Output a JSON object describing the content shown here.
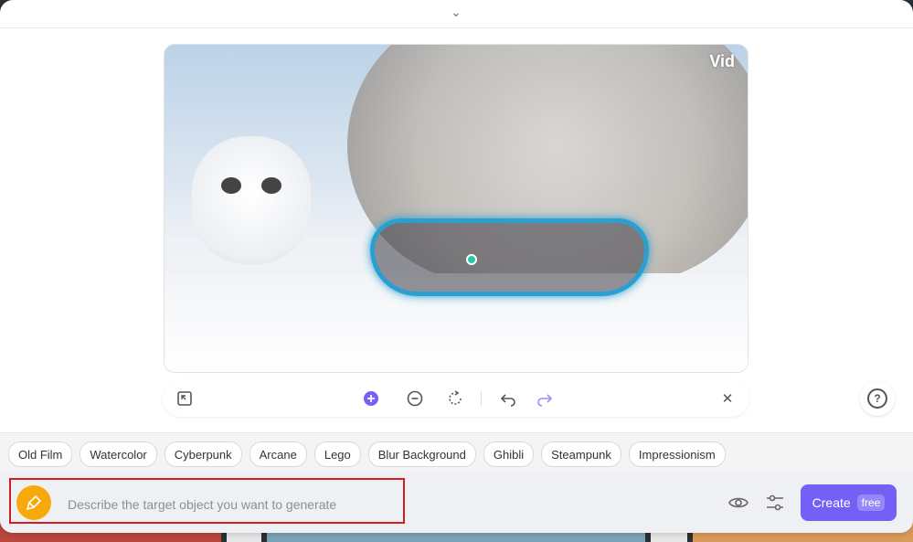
{
  "preview": {
    "watermark": "Vid"
  },
  "toolbar": {
    "icons": [
      "fit-screen-icon",
      "add-mask-icon",
      "remove-mask-icon",
      "reset-icon",
      "undo-icon",
      "redo-icon",
      "close-icon"
    ]
  },
  "styles": [
    "Old Film",
    "Watercolor",
    "Cyberpunk",
    "Arcane",
    "Lego",
    "Blur Background",
    "Ghibli",
    "Steampunk",
    "Impressionism"
  ],
  "prompt": {
    "placeholder": "Describe the target object you want to generate",
    "value": ""
  },
  "create": {
    "label": "Create",
    "badge": "free"
  },
  "colors": {
    "accent": "#7560f5",
    "brush": "#f5a90a",
    "highlight": "#d11f1f",
    "mask": "#2a9fd0"
  }
}
